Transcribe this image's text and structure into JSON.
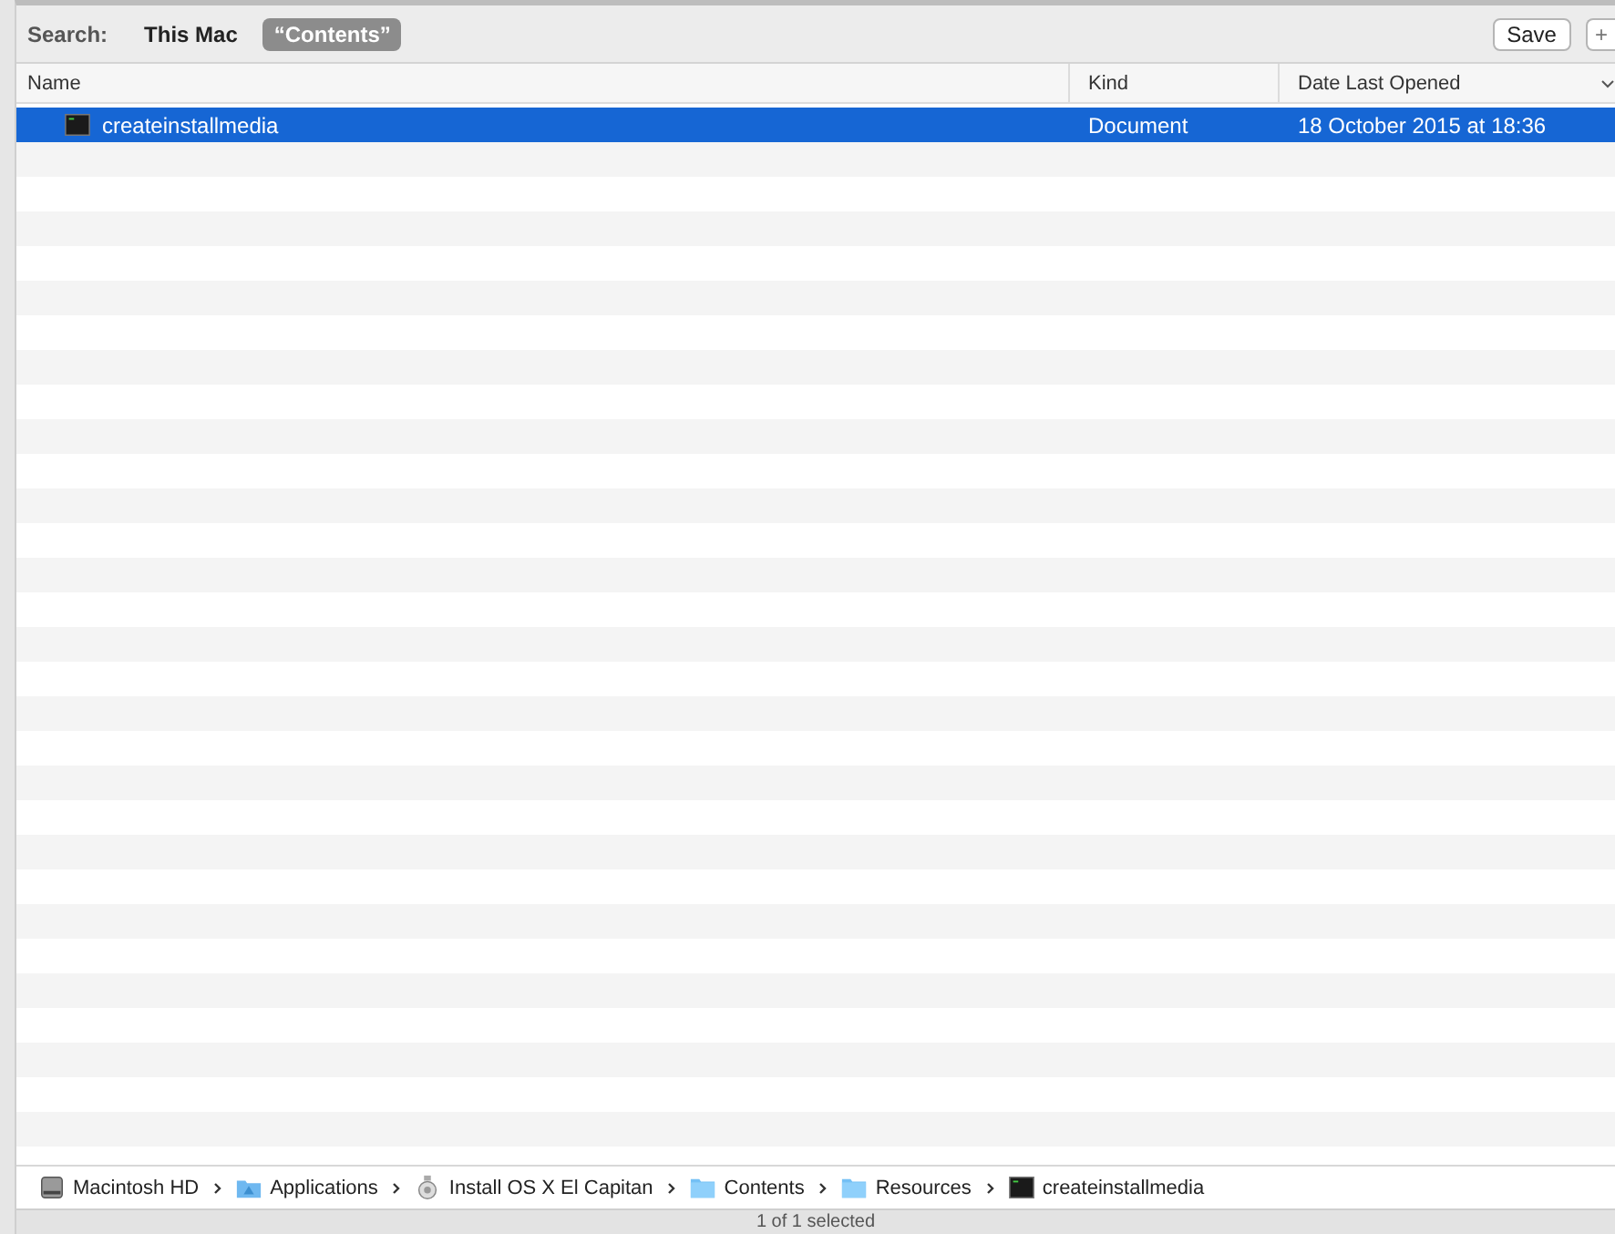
{
  "search_bar": {
    "label": "Search:",
    "scopes": [
      {
        "label": "This Mac",
        "selected": false
      },
      {
        "label": "“Contents”",
        "selected": true
      }
    ],
    "buttons": [
      "Save",
      "+"
    ]
  },
  "table": {
    "columns": [
      {
        "label": "Name",
        "sorted": false
      },
      {
        "label": "Kind",
        "sorted": false
      },
      {
        "label": "Date Last Opened",
        "sorted": true
      }
    ],
    "rows": [
      {
        "name": "createinstallmedia",
        "kind": "Document",
        "date_last_opened": "18 October 2015 at 18:36",
        "selected": true
      }
    ]
  },
  "path_bar": [
    {
      "label": "Macintosh HD",
      "kind": "disk"
    },
    {
      "label": "Applications",
      "kind": "apps"
    },
    {
      "label": "Install OS X El Capitan",
      "kind": "installer"
    },
    {
      "label": "Contents",
      "kind": "folder"
    },
    {
      "label": "Resources",
      "kind": "folder"
    },
    {
      "label": "createinstallmedia",
      "kind": "executable"
    }
  ],
  "status_bar": {
    "text": "1 of 1 selected"
  }
}
